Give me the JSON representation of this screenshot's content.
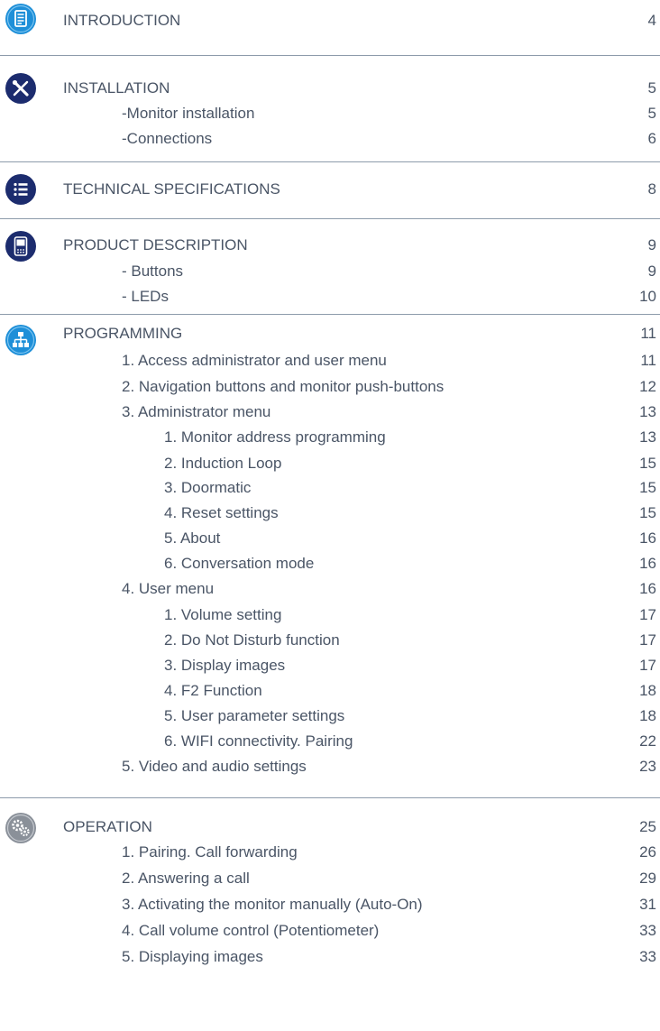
{
  "sections": [
    {
      "title": "INTRODUCTION",
      "page": "4",
      "icon": "document-icon",
      "items": []
    },
    {
      "title": "INSTALLATION",
      "page": "5",
      "icon": "tools-icon",
      "items": [
        {
          "label": "-Monitor installation",
          "page": "5"
        },
        {
          "label": "-Connections",
          "page": "6"
        }
      ]
    },
    {
      "title": "TECHNICAL SPECIFICATIONS",
      "page": "8",
      "icon": "list-icon",
      "items": []
    },
    {
      "title": "PRODUCT DESCRIPTION",
      "page": "9",
      "icon": "monitor-icon",
      "items": [
        {
          "label": "- Buttons",
          "page": "9"
        },
        {
          "label": "- LEDs",
          "page": "10"
        }
      ]
    },
    {
      "title": "PROGRAMMING",
      "page": "11",
      "icon": "sitemap-icon",
      "items": [
        {
          "label": "1. Access administrator and user menu",
          "page": "11"
        },
        {
          "label": "2. Navigation buttons and monitor push-buttons",
          "page": "12"
        },
        {
          "label": "3. Administrator menu",
          "page": "13"
        },
        {
          "label": "1. Monitor address programming",
          "page": "13"
        },
        {
          "label": "2. Induction Loop",
          "page": "15"
        },
        {
          "label": "3. Doormatic",
          "page": "15"
        },
        {
          "label": "4. Reset settings",
          "page": "15"
        },
        {
          "label": "5. About",
          "page": "16"
        },
        {
          "label": "6. Conversation mode",
          "page": "16"
        },
        {
          "label": "4. User menu",
          "page": "16"
        },
        {
          "label": "1. Volume setting",
          "page": "17"
        },
        {
          "label": "2. Do Not Disturb function",
          "page": "17"
        },
        {
          "label": "3. Display images",
          "page": "17"
        },
        {
          "label": "4. F2 Function",
          "page": "18"
        },
        {
          "label": "5. User parameter settings",
          "page": "18"
        },
        {
          "label": "6. WIFI connectivity. Pairing",
          "page": "22"
        },
        {
          "label": "5. Video and audio settings",
          "page": "23"
        }
      ]
    },
    {
      "title": "OPERATION",
      "page": "25",
      "icon": "gears-icon",
      "items": [
        {
          "label": "1. Pairing. Call forwarding",
          "page": "26"
        },
        {
          "label": "2. Answering a call",
          "page": "29"
        },
        {
          "label": "3. Activating the monitor manually (Auto-On)",
          "page": "31"
        },
        {
          "label": "4. Call volume control (Potentiometer)",
          "page": "33"
        },
        {
          "label": "5. Displaying images",
          "page": "33"
        }
      ]
    }
  ],
  "colors": {
    "text": "#4a5566",
    "divider": "#8d9bab",
    "icon_blue": "#1e8fd8",
    "icon_navy": "#1c2c6e",
    "icon_gray": "#8a9099"
  }
}
